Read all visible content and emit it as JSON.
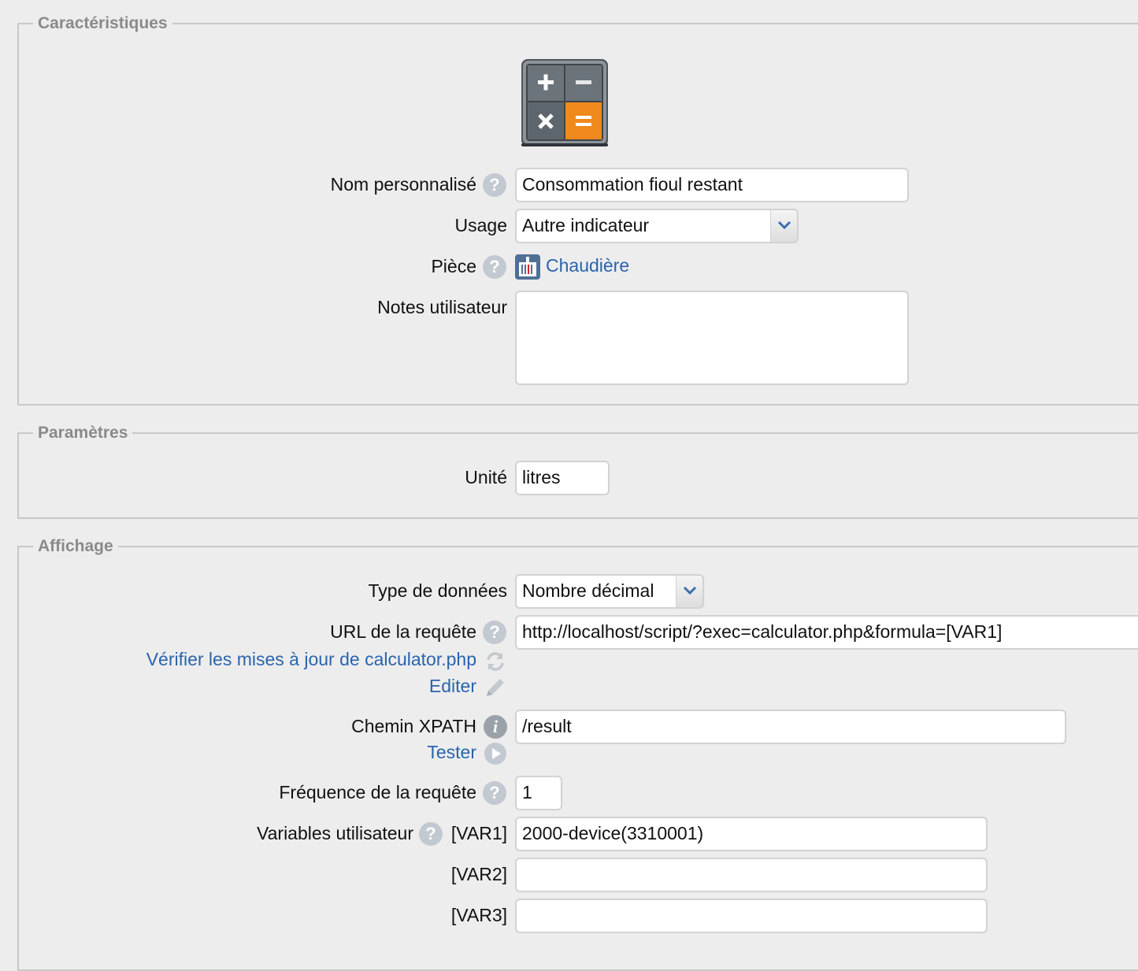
{
  "sections": {
    "caracteristiques": "Caractéristiques",
    "parametres": "Paramètres",
    "affichage": "Affichage"
  },
  "icon": "calculator-icon",
  "help_glyph": "?",
  "info_glyph": "i",
  "characteristics": {
    "name_label": "Nom personnalisé",
    "name_value": "Consommation fioul restant",
    "usage_label": "Usage",
    "usage_value": "Autre indicateur",
    "room_label": "Pièce",
    "room_value": "Chaudière",
    "notes_label": "Notes utilisateur",
    "notes_value": ""
  },
  "parameters": {
    "unit_label": "Unité",
    "unit_value": "litres"
  },
  "display": {
    "type_label": "Type de données",
    "type_value": "Nombre décimal",
    "url_label": "URL de la requête",
    "url_value": "http://localhost/script/?exec=calculator.php&formula=[VAR1]",
    "check_updates_link": "Vérifier les mises à jour de calculator.php",
    "edit_link": "Editer",
    "xpath_label": "Chemin XPATH",
    "xpath_value": "/result",
    "test_link": "Tester",
    "frequency_label": "Fréquence de la requête",
    "frequency_value": "1",
    "vars_label": "Variables utilisateur",
    "var1_label": "[VAR1]",
    "var1_value": "2000-device(3310001)",
    "var2_label": "[VAR2]",
    "var2_value": "",
    "var3_label": "[VAR3]",
    "var3_value": ""
  },
  "colors": {
    "link": "#2a64ad",
    "accent_orange": "#f08a1c",
    "calc_gray": "#5d656c"
  }
}
